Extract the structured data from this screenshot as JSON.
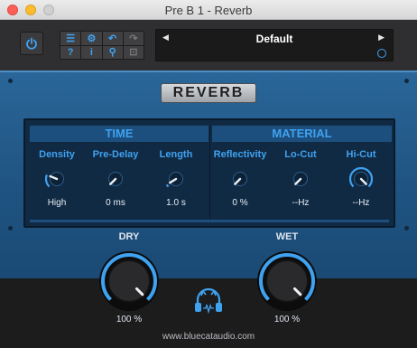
{
  "window": {
    "title": "Pre B 1 - Reverb"
  },
  "toolbar": {
    "power_icon": "power-icon",
    "tools": [
      {
        "icon": "menu-icon",
        "glyph": "☰"
      },
      {
        "icon": "settings-gear-icon",
        "glyph": "⚙"
      },
      {
        "icon": "undo-icon",
        "glyph": "↶"
      },
      {
        "icon": "redo-icon",
        "glyph": "↷"
      },
      {
        "icon": "help-icon",
        "glyph": "?"
      },
      {
        "icon": "info-icon",
        "glyph": "i"
      },
      {
        "icon": "search-icon",
        "glyph": "⚲"
      },
      {
        "icon": "lock-icon",
        "glyph": "⊡"
      }
    ],
    "preset": {
      "name": "Default",
      "prev_icon": "◀",
      "next_icon": "▶"
    }
  },
  "plugin": {
    "title": "REVERB",
    "sections": {
      "time": "TIME",
      "material": "MATERIAL"
    },
    "knobs": [
      {
        "label": "Density",
        "value": "High",
        "level": 0.25
      },
      {
        "label": "Pre-Delay",
        "value": "0 ms",
        "level": 0.0
      },
      {
        "label": "Length",
        "value": "1.0 s",
        "level": 0.05
      },
      {
        "label": "Reflectivity",
        "value": "0 %",
        "level": 0.0
      },
      {
        "label": "Lo-Cut",
        "value": "--Hz",
        "level": 0.0
      },
      {
        "label": "Hi-Cut",
        "value": "--Hz",
        "level": 1.0
      }
    ]
  },
  "mix": {
    "dry": {
      "label": "DRY",
      "value": "100 %",
      "level": 1.0
    },
    "wet": {
      "label": "WET",
      "value": "100 %",
      "level": 1.0
    }
  },
  "footer": {
    "url": "www.bluecataudio.com",
    "logo_icon": "blue-cat-headphones-logo-icon"
  },
  "colors": {
    "accent": "#3fa2f0",
    "panel": "#1f5482",
    "panel_dark": "#112a44",
    "host": "#2f2f31"
  }
}
